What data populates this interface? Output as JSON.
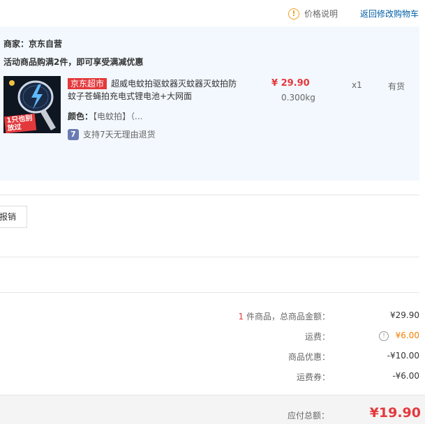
{
  "header": {
    "price_note": "价格说明",
    "back_link": "返回修改购物车"
  },
  "shop": {
    "merchant_label": "商家：",
    "merchant_name": "京东自营",
    "promo_text": "活动商品购满2件，即可享受满减优惠",
    "item": {
      "tag": "京东超市",
      "title": "超威电蚊拍驱蚊器灭蚊器灭蚊拍防蚊子苍蝇拍充电式锂电池+大网面",
      "thumb_badge": "1只也别放过",
      "price": "¥ 29.90",
      "weight": "0.300kg",
      "qty": "x1",
      "stock": "有货",
      "spec_label": "颜色：",
      "spec_value": "【电蚊拍】（...",
      "return_icon": "7",
      "return_text": "支持7天无理由退货"
    }
  },
  "invoice": {
    "button_label": "报销"
  },
  "summary": {
    "items_count": "1",
    "items_label": " 件商品，总商品金额：",
    "items_amount": "¥29.90",
    "shipping_label": "运费：",
    "shipping_amount": "¥6.00",
    "discount_label": "商品优惠：",
    "discount_amount": "-¥10.00",
    "coupon_label": "运费券：",
    "coupon_amount": "-¥6.00",
    "total_label": "应付总额：",
    "total_amount": "¥19.90"
  },
  "colors": {
    "accent_red": "#e4393c",
    "link_blue": "#005ea7",
    "shipping_orange": "#f57e00",
    "panel_bg": "#f3f8fe"
  },
  "icons": {
    "price_note": "warning-circle-icon",
    "return": "seven-day-return-icon",
    "shipping_info": "info-circle-icon"
  }
}
